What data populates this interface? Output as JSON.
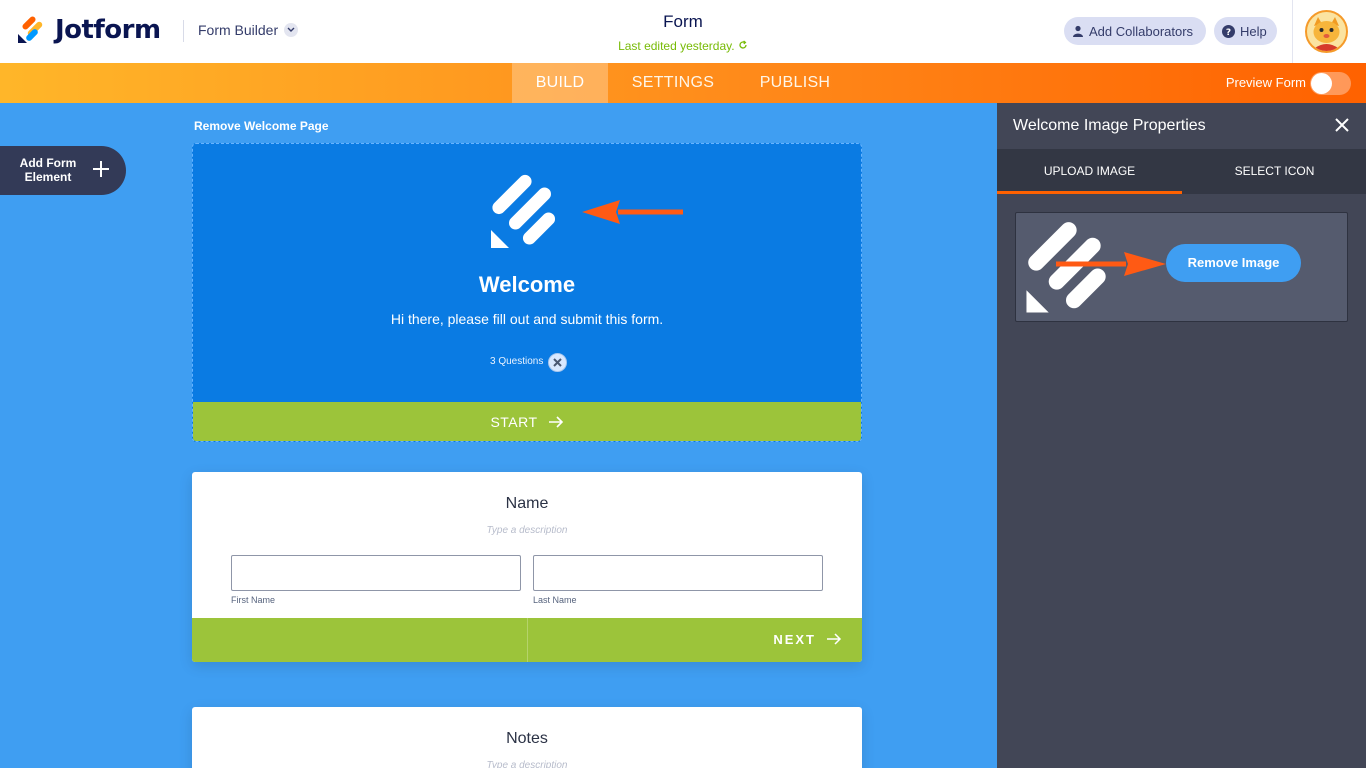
{
  "header": {
    "brand": "Jotform",
    "builder_label": "Form Builder",
    "form_title": "Form",
    "last_edited": "Last edited yesterday.",
    "add_collaborators": "Add Collaborators",
    "help": "Help"
  },
  "nav": {
    "tabs": [
      {
        "label": "BUILD",
        "active": true
      },
      {
        "label": "SETTINGS",
        "active": false
      },
      {
        "label": "PUBLISH",
        "active": false
      }
    ],
    "preview_form": "Preview Form",
    "preview_enabled": false
  },
  "sidebar": {
    "add_element_label": "Add Form Element"
  },
  "canvas": {
    "remove_welcome_page": "Remove Welcome Page",
    "welcome": {
      "title": "Welcome",
      "subtitle": "Hi there, please fill out and submit this form.",
      "questions": "3 Questions",
      "start_label": "START"
    },
    "name_field": {
      "title": "Name",
      "description_placeholder": "Type a description",
      "first_label": "First Name",
      "last_label": "Last Name",
      "first_value": "",
      "last_value": "",
      "next_label": "NEXT"
    },
    "notes_field": {
      "title": "Notes",
      "description_placeholder": "Type a description"
    }
  },
  "panel": {
    "title": "Welcome Image Properties",
    "tabs": [
      {
        "label": "UPLOAD IMAGE",
        "active": true
      },
      {
        "label": "SELECT ICON",
        "active": false
      }
    ],
    "remove_image": "Remove Image"
  },
  "colors": {
    "canvas_bg": "#3f9ef2",
    "welcome_bg": "#0a7be3",
    "green_bar": "#9cc43a",
    "orange_accent": "#ff6100",
    "panel_bg": "#424656",
    "brand_navy": "#0a1551"
  },
  "icons": {
    "logo": "jotform-logo-icon",
    "chevron": "chevron-down-icon",
    "refresh": "refresh-icon",
    "user": "user-icon",
    "help": "question-icon",
    "plus": "plus-icon",
    "close": "close-icon",
    "arrow_right": "arrow-right-icon"
  }
}
